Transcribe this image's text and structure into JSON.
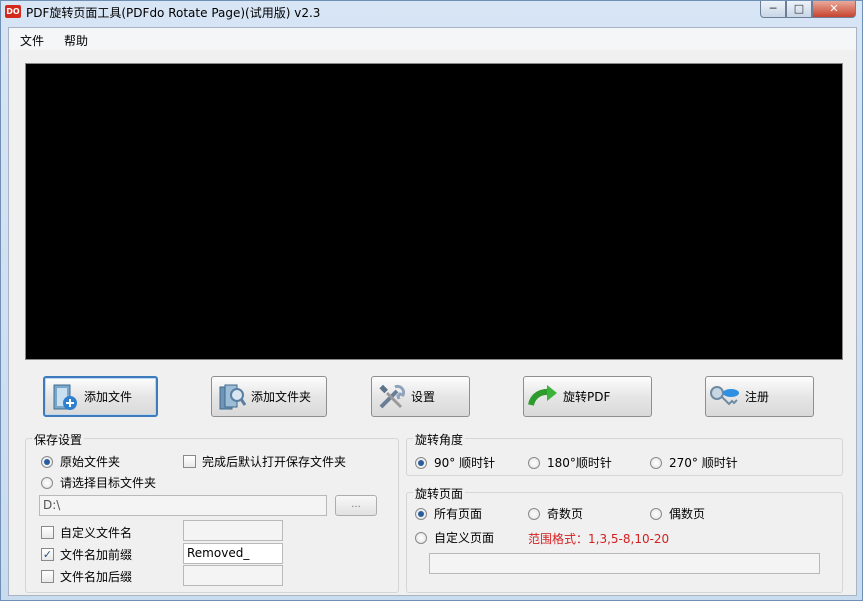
{
  "window": {
    "title": "PDF旋转页面工具(PDFdo Rotate Page)(试用版) v2.3",
    "icon_text": "DO",
    "controls": {
      "minimize": "─",
      "maximize": "□",
      "close": "✕"
    }
  },
  "menu": {
    "file": "文件",
    "help": "帮助"
  },
  "toolbar": {
    "add_file": "添加文件",
    "add_folder": "添加文件夹",
    "settings": "设置",
    "rotate_pdf": "旋转PDF",
    "register": "注册"
  },
  "save_settings": {
    "title": "保存设置",
    "original_folder": "原始文件夹",
    "open_after": "完成后默认打开保存文件夹",
    "choose_target": "请选择目标文件夹",
    "path_value": "D:\\",
    "browse": "...",
    "custom_name": "自定义文件名",
    "add_prefix": "文件名加前缀",
    "prefix_value": "Removed_",
    "add_suffix": "文件名加后缀"
  },
  "rotate_angle": {
    "title": "旋转角度",
    "opt90": "90° 顺时针",
    "opt180": "180°顺时针",
    "opt270": "270° 顺时针"
  },
  "rotate_pages": {
    "title": "旋转页面",
    "all": "所有页面",
    "odd": "奇数页",
    "even": "偶数页",
    "custom": "自定义页面",
    "range_hint": "范围格式：1,3,5-8,10-20"
  },
  "colors": {
    "hint": "#d41f1f",
    "preview_bg": "#000000"
  }
}
